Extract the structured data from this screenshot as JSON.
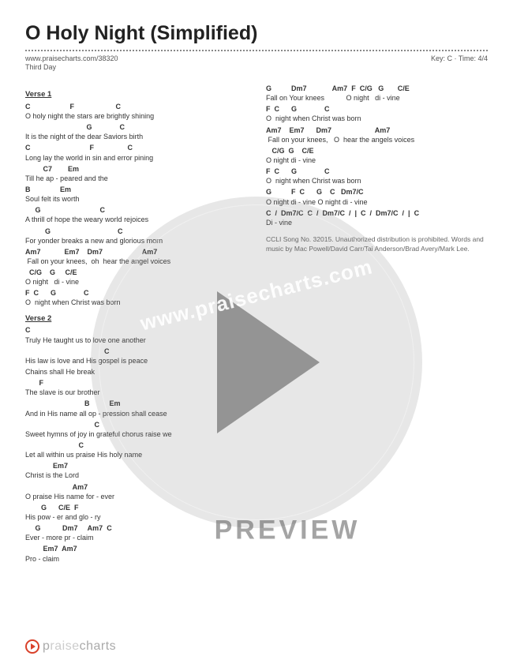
{
  "header": {
    "title": "O Holy Night (Simplified)",
    "url": "www.praisecharts.com/38320",
    "key_time": "Key: C · Time: 4/4",
    "artist": "Third Day"
  },
  "sections": {
    "verse1_label": "Verse 1",
    "verse2_label": "Verse 2"
  },
  "v1": {
    "c1": "C                    F                     C",
    "l1": "O holy night the stars are brightly shining",
    "c2": "                               G              C",
    "l2": "It is the night of the dear Saviors birth",
    "c3": "C                              F                 C",
    "l3": "Long lay the world in sin and error pining",
    "c4": "         C7        Em",
    "l4": "Till he ap - peared and the",
    "c5": "B               Em",
    "l5": "Soul felt its worth",
    "c6": "     G                              C",
    "l6": "A thrill of hope the weary world rejoices",
    "c7": "          G                                  C",
    "l7": "For yonder breaks a new and glorious morn",
    "c8": "Am7            Em7    Dm7                    Am7",
    "l8": " Fall on your knees,  oh  hear the angel voices",
    "c9": "  C/G    G     C/E",
    "l9": "O night   di - vine",
    "c10": "F  C      G              C",
    "l10": "O  night when Christ was born"
  },
  "v2": {
    "c1": "C",
    "l1": "Truly He taught us to love one another",
    "c2": "                                        C",
    "l2": "His law is love and His gospel is peace",
    "l3": "Chains shall He break",
    "c4": "       F",
    "l4": "The slave is our brother",
    "c5": "                              B          Em",
    "l5": "And in His name all op - pression shall cease",
    "c6": "                                   C",
    "l6": "Sweet hymns of joy in grateful chorus raise we",
    "c7": "                           C",
    "l7": "Let all within us praise His holy name",
    "c8": "              Em7",
    "l8": "Christ is the Lord",
    "c9": "                        Am7",
    "l9": "O praise His name for - ever",
    "c10": "        G      C/E  F",
    "l10": "His pow - er and glo - ry",
    "c11": "     G           Dm7     Am7  C",
    "l11": "Ever - more pr - claim",
    "c12": "         Em7  Am7",
    "l12": "Pro - claim"
  },
  "r": {
    "c1": "G          Dm7             Am7  F  C/G   G       C/E",
    "l1": "Fall on Your knees           O night   di - vine",
    "c2": "F  C      G              C",
    "l2": "O  night when Christ was born",
    "c3": "Am7    Em7      Dm7                      Am7",
    "l3": " Fall on your knees,   O  hear the angels voices",
    "c4": "   C/G  G    C/E",
    "l4": "O night di - vine",
    "c5": "F  C      G              C",
    "l5": "O  night when Christ was born",
    "c6": "G          F  C      G    C   Dm7/C",
    "l6": "O night di - vine O night di - vine",
    "c7": "C  /  Dm7/C  C  /  Dm7/C  /  |  C  /  Dm7/C  /  |  C",
    "l7": "Di - vine"
  },
  "ccli": "CCLI Song No. 32015. Unauthorized distribution is prohibited. Words and music by Mac Powell/David Carr/Tai Anderson/Brad Avery/Mark Lee.",
  "watermark": {
    "url": "www.praisecharts.com",
    "preview": "PREVIEW"
  },
  "footer": {
    "brand_prefix": "p",
    "brand_mid": "raise",
    "brand_suffix": "charts"
  }
}
